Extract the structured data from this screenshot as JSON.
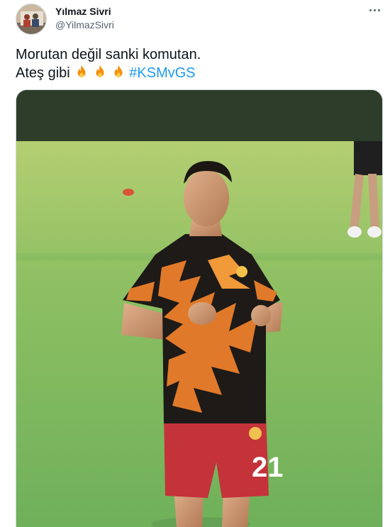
{
  "author": {
    "display_name": "Yılmaz Sivri",
    "handle": "@YilmazSivri",
    "avatar_icon": "user-avatar"
  },
  "more_icon": "more-options-icon",
  "tweet": {
    "line1": "Morutan değil sanki komutan.",
    "line2_text": "Ateş gibi",
    "emoji": [
      "fire",
      "fire",
      "fire"
    ],
    "hashtag": "#KSMvGS"
  },
  "media": {
    "description_icon": "photo",
    "jersey_number": "21"
  },
  "colors": {
    "link": "#1d9bf0",
    "text": "#0f1419",
    "secondary": "#536471",
    "border": "#cfd9de"
  }
}
